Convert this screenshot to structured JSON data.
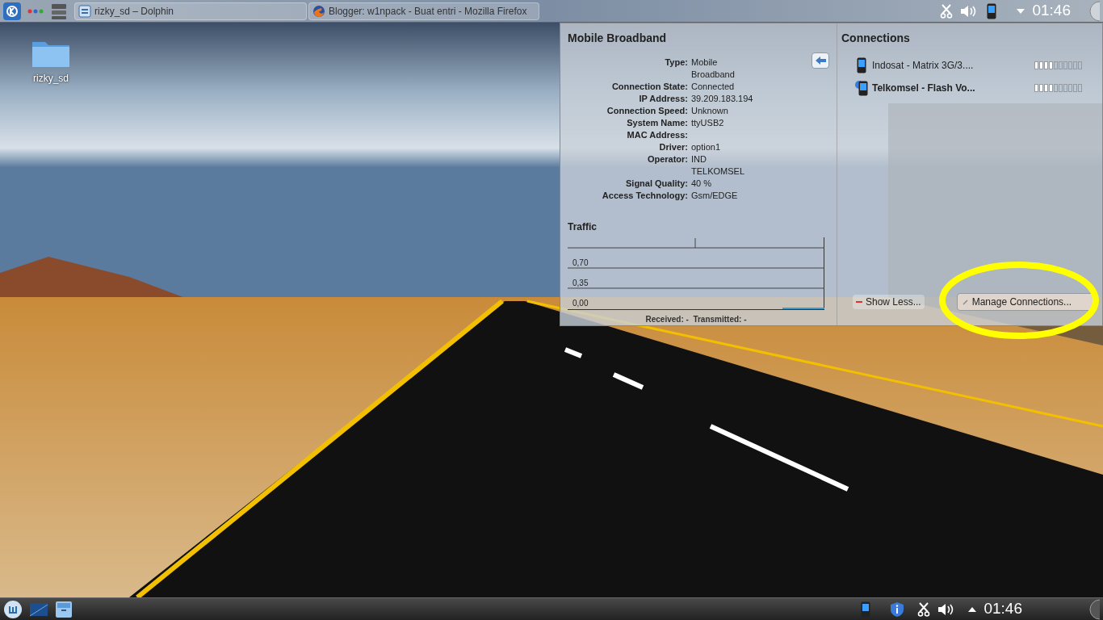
{
  "top_panel": {
    "tasks": [
      {
        "title": "rizky_sd – Dolphin",
        "kind": "folder"
      },
      {
        "title": "Blogger: w1npack - Buat entri - Mozilla Firefox",
        "kind": "browser"
      }
    ],
    "clock": "01:46"
  },
  "desktop_icons": [
    {
      "label": "rizky_sd"
    }
  ],
  "details": {
    "title": "Mobile Broadband",
    "rows": [
      {
        "label": "Type:",
        "value": "Mobile Broadband"
      },
      {
        "label": "Connection State:",
        "value": "Connected"
      },
      {
        "label": "IP Address:",
        "value": "39.209.183.194"
      },
      {
        "label": "Connection Speed:",
        "value": "Unknown"
      },
      {
        "label": "System Name:",
        "value": "ttyUSB2"
      },
      {
        "label": "MAC Address:"
      },
      {
        "label": "Driver:",
        "value": "option1"
      },
      {
        "label": "Operator:",
        "value": "IND TELKOMSEL"
      },
      {
        "label": "Signal Quality:",
        "value": "40 %"
      },
      {
        "label": "Access Technology:",
        "value": "Gsm/EDGE"
      }
    ]
  },
  "traffic": {
    "title": "Traffic",
    "y_labels": [
      "0,70",
      "0,35",
      "0,00"
    ],
    "summary": "Received: -  Transmitted: -"
  },
  "connections": {
    "title": "Connections",
    "items": [
      {
        "name": "Indosat - Matrix 3G/3....",
        "active": false,
        "level": 0.4
      },
      {
        "name": "Telkomsel - Flash Vo...",
        "active": true,
        "level": 0.4
      }
    ]
  },
  "buttons": {
    "show_less": "Show Less...",
    "manage": "Manage Connections..."
  },
  "bottom_panel": {
    "clock": "01:46"
  }
}
